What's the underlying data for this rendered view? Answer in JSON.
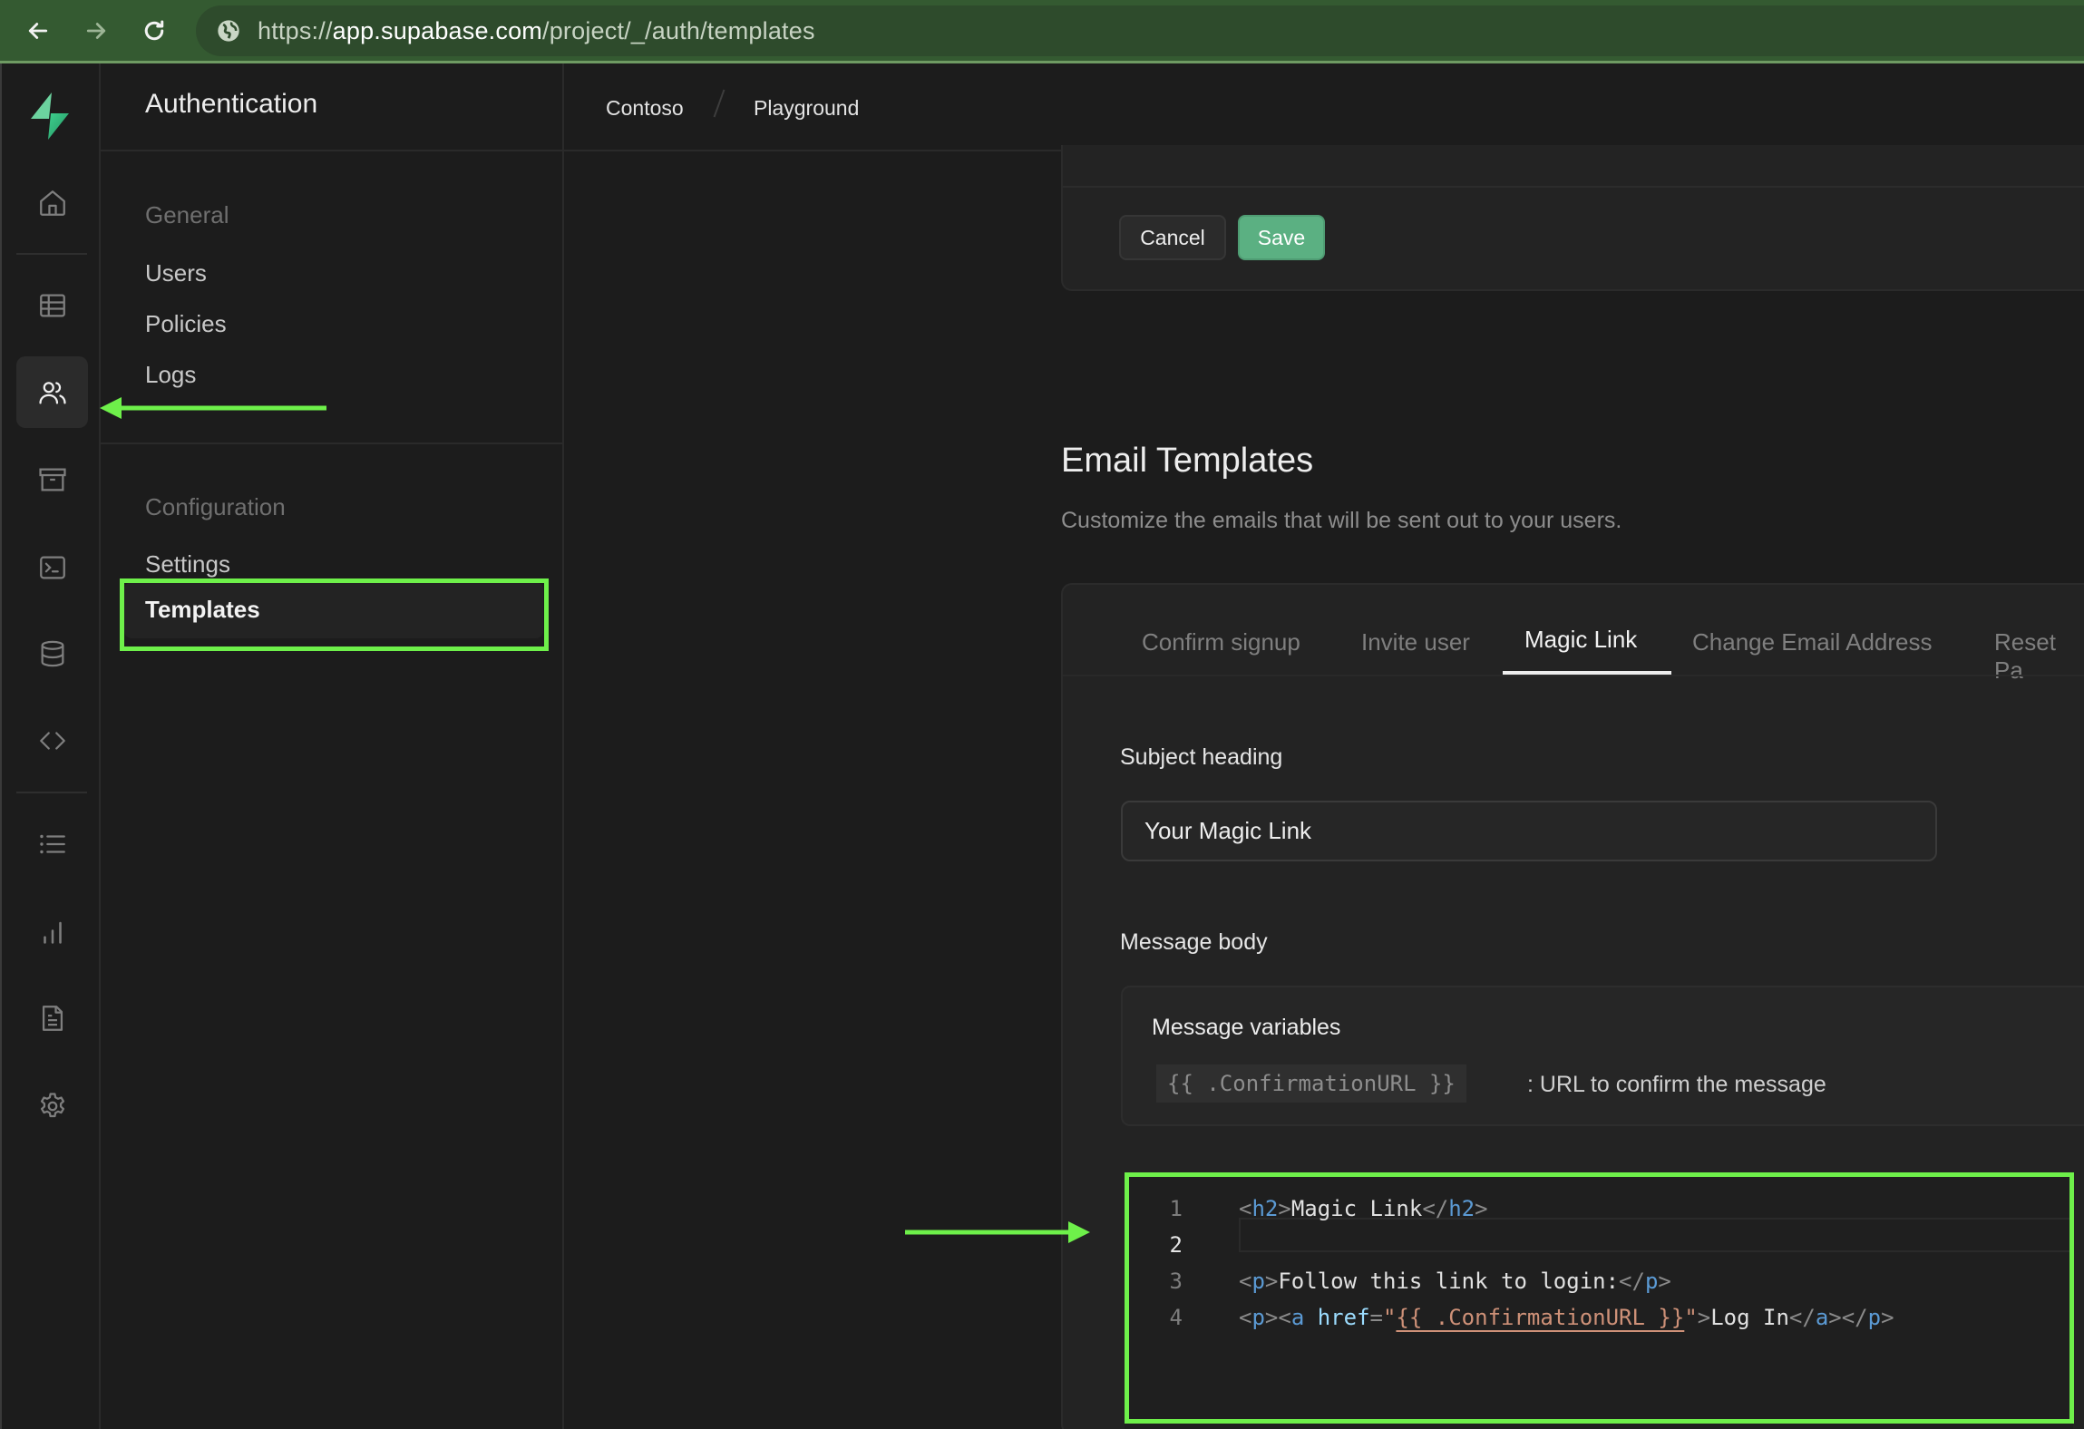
{
  "browser": {
    "url_prefix": "https://",
    "url_host": "app.supabase.com",
    "url_path": "/project/_/auth/templates",
    "icons": [
      "back-arrow-icon",
      "forward-arrow-icon",
      "reload-icon",
      "site-info-icon"
    ]
  },
  "rail": {
    "items": [
      {
        "name": "home",
        "icon": "home-icon"
      },
      {
        "name": "table-editor",
        "icon": "table-icon"
      },
      {
        "name": "authentication",
        "icon": "users-icon",
        "active": true
      },
      {
        "name": "storage",
        "icon": "archive-icon"
      },
      {
        "name": "sql-editor",
        "icon": "terminal-icon"
      },
      {
        "name": "database",
        "icon": "database-icon"
      },
      {
        "name": "api",
        "icon": "code-icon"
      },
      {
        "name": "logs",
        "icon": "list-icon"
      },
      {
        "name": "reports",
        "icon": "bar-chart-icon"
      },
      {
        "name": "docs",
        "icon": "document-icon"
      },
      {
        "name": "settings",
        "icon": "gear-icon"
      }
    ]
  },
  "submenu": {
    "title": "Authentication",
    "sections": [
      {
        "label": "General",
        "items": [
          "Users",
          "Policies",
          "Logs"
        ]
      },
      {
        "label": "Configuration",
        "items": [
          "Settings",
          "Templates"
        ]
      }
    ],
    "active_item": "Templates"
  },
  "breadcrumb": {
    "org": "Contoso",
    "project": "Playground"
  },
  "actions": {
    "cancel_label": "Cancel",
    "save_label": "Save"
  },
  "email_templates": {
    "title": "Email Templates",
    "subtitle": "Customize the emails that will be sent out to your users.",
    "tabs": [
      "Confirm signup",
      "Invite user",
      "Magic Link",
      "Change Email Address",
      "Reset Pa"
    ],
    "active_tab": "Magic Link",
    "subject_label": "Subject heading",
    "subject_value": "Your Magic Link",
    "body_label": "Message body",
    "variables_title": "Message variables",
    "variables": [
      {
        "token": "{{ .ConfirmationURL }}",
        "description": ": URL to confirm the message"
      }
    ],
    "editor": {
      "line_numbers": [
        "1",
        "2",
        "3",
        "4"
      ],
      "current_line": 2,
      "lines": [
        "<h2>Magic Link</h2>",
        "",
        "<p>Follow this link to login:</p>",
        "<p><a href=\"{{ .ConfirmationURL }}\">Log In</a></p>"
      ],
      "tokens": {
        "l1": {
          "o1": "<",
          "tag1": "h2",
          "c1": ">",
          "text": "Magic Link",
          "o2": "</",
          "tag2": "h2",
          "c2": ">"
        },
        "l3": {
          "o1": "<",
          "tag1": "p",
          "c1": ">",
          "text": "Follow this link to login:",
          "o2": "</",
          "tag2": "p",
          "c2": ">"
        },
        "l4": {
          "o1": "<",
          "tag1": "p",
          "c1": "><",
          "tag2": "a",
          "sp": " ",
          "attr": "href",
          "eq": "=",
          "q1": "\"",
          "tmpl": "{{ .ConfirmationURL }}",
          "q2": "\"",
          "c2": ">",
          "text": "Log In",
          "o3": "</",
          "tag3": "a",
          "c3": "></",
          "tag4": "p",
          "c4": ">"
        }
      }
    }
  },
  "annotations": {
    "highlight_color": "#6ef04a"
  },
  "colors": {
    "brand_green": "#3ecf8e",
    "save_button": "#5bb082",
    "browser_bar": "#345a31"
  }
}
